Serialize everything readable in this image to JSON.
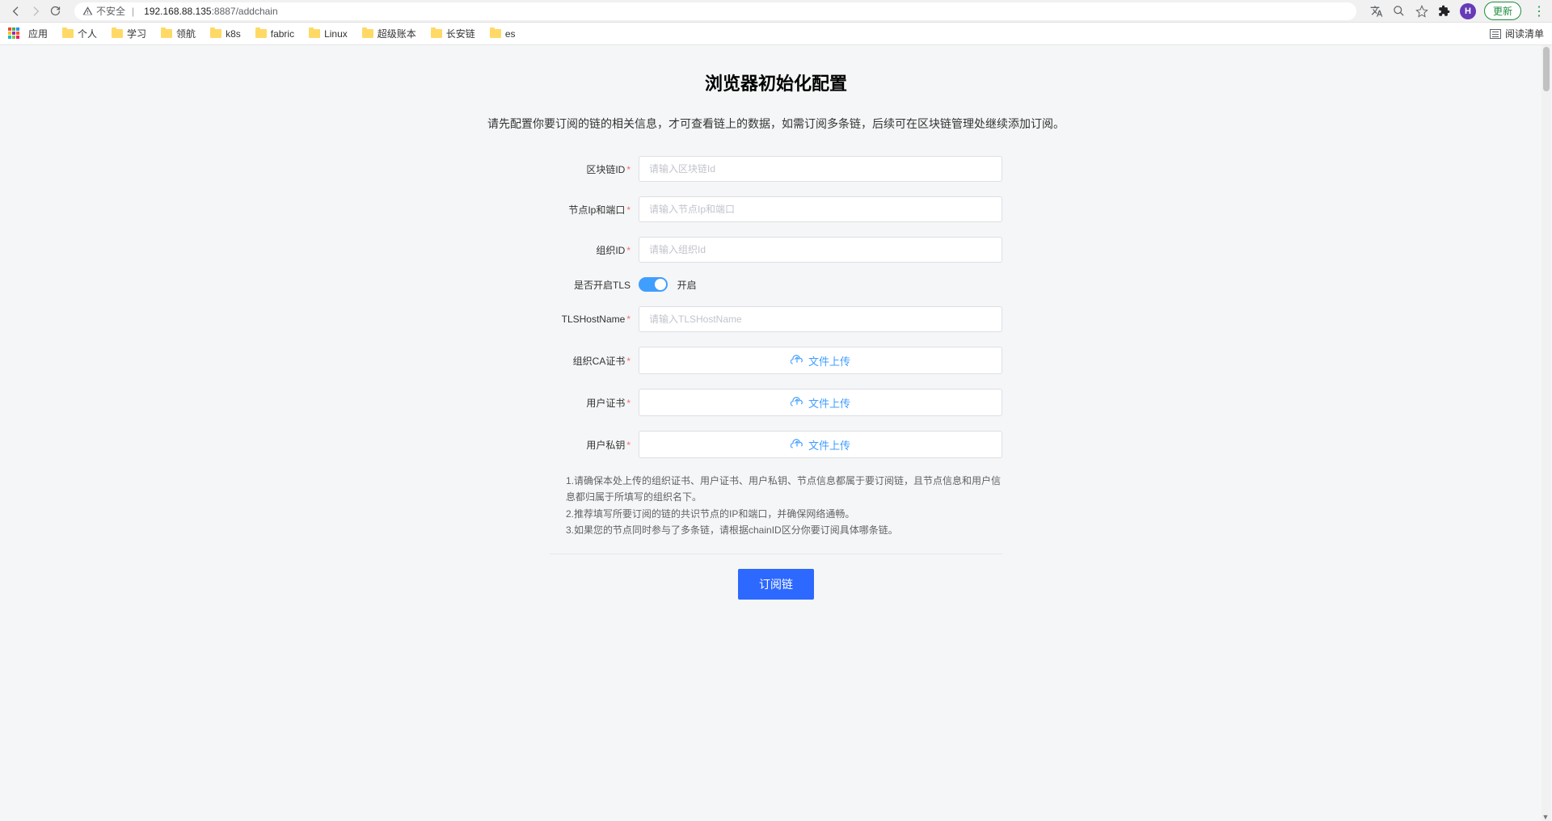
{
  "chrome": {
    "insecure_label": "不安全",
    "url_host": "192.168.88.135",
    "url_port_path": ":8887/addchain",
    "avatar_letter": "H",
    "update_label": "更新"
  },
  "bookmarks": {
    "apps_label": "应用",
    "items": [
      "个人",
      "学习",
      "领航",
      "k8s",
      "fabric",
      "Linux",
      "超级账本",
      "长安链",
      "es"
    ],
    "reading_list": "阅读清单"
  },
  "page": {
    "title": "浏览器初始化配置",
    "subtitle": "请先配置你要订阅的链的相关信息，才可查看链上的数据，如需订阅多条链，后续可在区块链管理处继续添加订阅。"
  },
  "form": {
    "chain_id": {
      "label": "区块链ID",
      "placeholder": "请输入区块链Id"
    },
    "node": {
      "label": "节点Ip和端口",
      "placeholder": "请输入节点Ip和端口"
    },
    "org_id": {
      "label": "组织ID",
      "placeholder": "请输入组织Id"
    },
    "tls": {
      "label": "是否开启TLS",
      "switch_text": "开启"
    },
    "tls_host": {
      "label": "TLSHostName",
      "placeholder": "请输入TLSHostName"
    },
    "org_ca": {
      "label": "组织CA证书"
    },
    "user_cert": {
      "label": "用户证书"
    },
    "user_key": {
      "label": "用户私钥"
    },
    "upload_text": "文件上传"
  },
  "tips": {
    "l1": "1.请确保本处上传的组织证书、用户证书、用户私钥、节点信息都属于要订阅链，且节点信息和用户信息都归属于所填写的组织名下。",
    "l2": "2.推荐填写所要订阅的链的共识节点的IP和端口，并确保网络通畅。",
    "l3": "3.如果您的节点同时参与了多条链，请根据chainID区分你要订阅具体哪条链。"
  },
  "submit": {
    "label": "订阅链"
  }
}
